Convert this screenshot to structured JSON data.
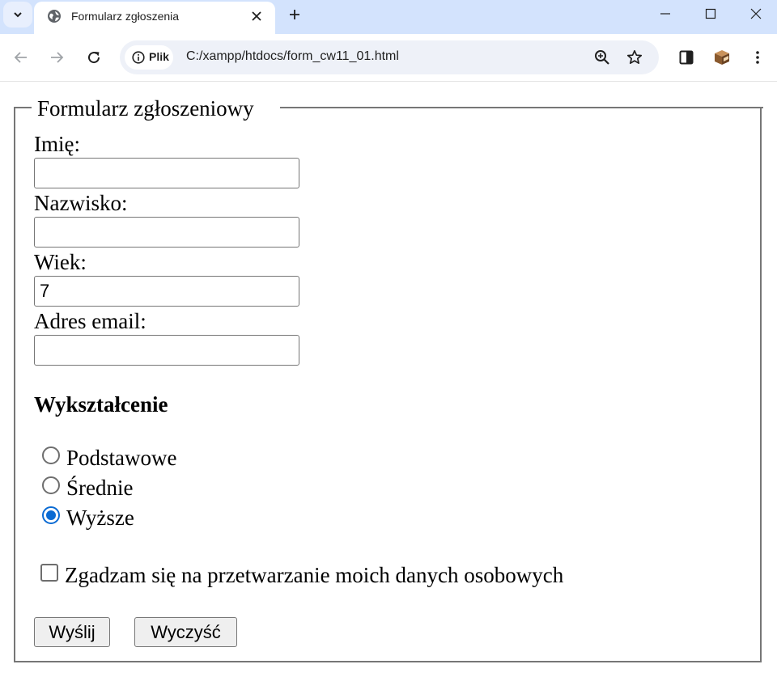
{
  "browser": {
    "tab_title": "Formularz zgłoszenia",
    "site_chip": "Plik",
    "url": "C:/xampp/htdocs/form_cw11_01.html",
    "icons": [
      "tab-search-icon",
      "globe-icon",
      "close-icon",
      "plus-icon",
      "minimize-icon",
      "maximize-icon",
      "window-close-icon",
      "back-icon",
      "forward-icon",
      "reload-icon",
      "info-icon",
      "zoom-icon",
      "star-icon",
      "side-panel-icon",
      "extension-icon",
      "menu-icon"
    ]
  },
  "form": {
    "legend": "Formularz zgłoszeniowy",
    "first_name_label": "Imię:",
    "first_name_value": "",
    "last_name_label": "Nazwisko:",
    "last_name_value": "",
    "age_label": "Wiek:",
    "age_value": "7",
    "email_label": "Adres email:",
    "email_value": "",
    "education_heading": "Wykształcenie",
    "education_options": [
      {
        "label": "Podstawowe",
        "checked": false
      },
      {
        "label": "Średnie",
        "checked": false
      },
      {
        "label": "Wyższe",
        "checked": true
      }
    ],
    "consent_label": "Zgadzam się na przetwarzanie moich danych osobowych",
    "consent_checked": false,
    "submit_label": "Wyślij",
    "reset_label": "Wyczyść"
  },
  "colors": {
    "tab_strip": "#d3e3fd",
    "omnibox": "#eef1f8",
    "radio_checked": "#0b6bd3",
    "fieldset_border": "#767676"
  }
}
